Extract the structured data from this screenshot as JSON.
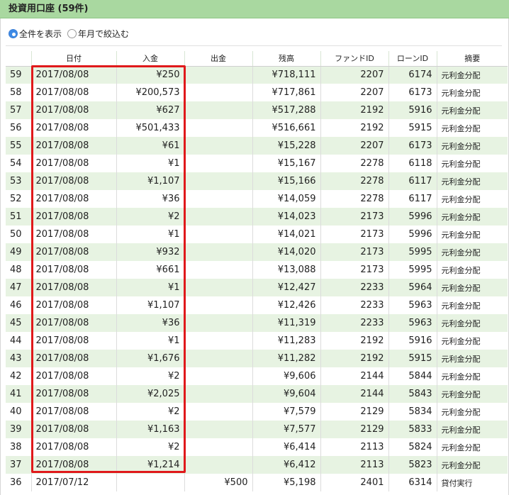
{
  "header": {
    "title": "投資用口座 (59件)"
  },
  "filter": {
    "options": [
      {
        "label": "全件を表示",
        "selected": true
      },
      {
        "label": "年月で絞込む",
        "selected": false
      }
    ]
  },
  "table": {
    "columns": [
      "",
      "日付",
      "入金",
      "出金",
      "残高",
      "ファンドID",
      "ローンID",
      "摘要"
    ],
    "rows": [
      {
        "no": "59",
        "date": "2017/08/08",
        "deposit": "¥250",
        "withdrawal": "",
        "balance": "¥718,111",
        "fund_id": "2207",
        "loan_id": "6174",
        "memo": "元利金分配"
      },
      {
        "no": "58",
        "date": "2017/08/08",
        "deposit": "¥200,573",
        "withdrawal": "",
        "balance": "¥717,861",
        "fund_id": "2207",
        "loan_id": "6173",
        "memo": "元利金分配"
      },
      {
        "no": "57",
        "date": "2017/08/08",
        "deposit": "¥627",
        "withdrawal": "",
        "balance": "¥517,288",
        "fund_id": "2192",
        "loan_id": "5916",
        "memo": "元利金分配"
      },
      {
        "no": "56",
        "date": "2017/08/08",
        "deposit": "¥501,433",
        "withdrawal": "",
        "balance": "¥516,661",
        "fund_id": "2192",
        "loan_id": "5915",
        "memo": "元利金分配"
      },
      {
        "no": "55",
        "date": "2017/08/08",
        "deposit": "¥61",
        "withdrawal": "",
        "balance": "¥15,228",
        "fund_id": "2207",
        "loan_id": "6173",
        "memo": "元利金分配"
      },
      {
        "no": "54",
        "date": "2017/08/08",
        "deposit": "¥1",
        "withdrawal": "",
        "balance": "¥15,167",
        "fund_id": "2278",
        "loan_id": "6118",
        "memo": "元利金分配"
      },
      {
        "no": "53",
        "date": "2017/08/08",
        "deposit": "¥1,107",
        "withdrawal": "",
        "balance": "¥15,166",
        "fund_id": "2278",
        "loan_id": "6117",
        "memo": "元利金分配"
      },
      {
        "no": "52",
        "date": "2017/08/08",
        "deposit": "¥36",
        "withdrawal": "",
        "balance": "¥14,059",
        "fund_id": "2278",
        "loan_id": "6117",
        "memo": "元利金分配"
      },
      {
        "no": "51",
        "date": "2017/08/08",
        "deposit": "¥2",
        "withdrawal": "",
        "balance": "¥14,023",
        "fund_id": "2173",
        "loan_id": "5996",
        "memo": "元利金分配"
      },
      {
        "no": "50",
        "date": "2017/08/08",
        "deposit": "¥1",
        "withdrawal": "",
        "balance": "¥14,021",
        "fund_id": "2173",
        "loan_id": "5996",
        "memo": "元利金分配"
      },
      {
        "no": "49",
        "date": "2017/08/08",
        "deposit": "¥932",
        "withdrawal": "",
        "balance": "¥14,020",
        "fund_id": "2173",
        "loan_id": "5995",
        "memo": "元利金分配"
      },
      {
        "no": "48",
        "date": "2017/08/08",
        "deposit": "¥661",
        "withdrawal": "",
        "balance": "¥13,088",
        "fund_id": "2173",
        "loan_id": "5995",
        "memo": "元利金分配"
      },
      {
        "no": "47",
        "date": "2017/08/08",
        "deposit": "¥1",
        "withdrawal": "",
        "balance": "¥12,427",
        "fund_id": "2233",
        "loan_id": "5964",
        "memo": "元利金分配"
      },
      {
        "no": "46",
        "date": "2017/08/08",
        "deposit": "¥1,107",
        "withdrawal": "",
        "balance": "¥12,426",
        "fund_id": "2233",
        "loan_id": "5963",
        "memo": "元利金分配"
      },
      {
        "no": "45",
        "date": "2017/08/08",
        "deposit": "¥36",
        "withdrawal": "",
        "balance": "¥11,319",
        "fund_id": "2233",
        "loan_id": "5963",
        "memo": "元利金分配"
      },
      {
        "no": "44",
        "date": "2017/08/08",
        "deposit": "¥1",
        "withdrawal": "",
        "balance": "¥11,283",
        "fund_id": "2192",
        "loan_id": "5916",
        "memo": "元利金分配"
      },
      {
        "no": "43",
        "date": "2017/08/08",
        "deposit": "¥1,676",
        "withdrawal": "",
        "balance": "¥11,282",
        "fund_id": "2192",
        "loan_id": "5915",
        "memo": "元利金分配"
      },
      {
        "no": "42",
        "date": "2017/08/08",
        "deposit": "¥2",
        "withdrawal": "",
        "balance": "¥9,606",
        "fund_id": "2144",
        "loan_id": "5844",
        "memo": "元利金分配"
      },
      {
        "no": "41",
        "date": "2017/08/08",
        "deposit": "¥2,025",
        "withdrawal": "",
        "balance": "¥9,604",
        "fund_id": "2144",
        "loan_id": "5843",
        "memo": "元利金分配"
      },
      {
        "no": "40",
        "date": "2017/08/08",
        "deposit": "¥2",
        "withdrawal": "",
        "balance": "¥7,579",
        "fund_id": "2129",
        "loan_id": "5834",
        "memo": "元利金分配"
      },
      {
        "no": "39",
        "date": "2017/08/08",
        "deposit": "¥1,163",
        "withdrawal": "",
        "balance": "¥7,577",
        "fund_id": "2129",
        "loan_id": "5833",
        "memo": "元利金分配"
      },
      {
        "no": "38",
        "date": "2017/08/08",
        "deposit": "¥2",
        "withdrawal": "",
        "balance": "¥6,414",
        "fund_id": "2113",
        "loan_id": "5824",
        "memo": "元利金分配"
      },
      {
        "no": "37",
        "date": "2017/08/08",
        "deposit": "¥1,214",
        "withdrawal": "",
        "balance": "¥6,412",
        "fund_id": "2113",
        "loan_id": "5823",
        "memo": "元利金分配"
      },
      {
        "no": "36",
        "date": "2017/07/12",
        "deposit": "",
        "withdrawal": "¥500",
        "balance": "¥5,198",
        "fund_id": "2401",
        "loan_id": "6314",
        "memo": "貸付実行"
      }
    ]
  },
  "colors": {
    "header_bg": "#a9d8a0",
    "row_alt_bg": "#e7f3e2",
    "highlight_border": "#e0191b",
    "radio_selected": "#3d8ae6"
  }
}
